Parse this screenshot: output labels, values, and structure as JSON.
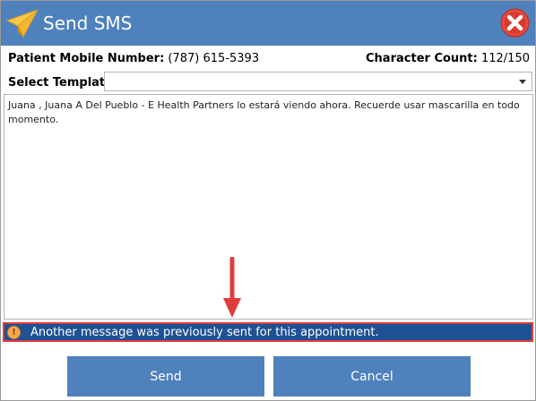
{
  "window": {
    "title": "Send SMS",
    "title_icon": "paper-plane-icon",
    "close_icon": "close-icon"
  },
  "info": {
    "mobile_label": "Patient Mobile Number:",
    "mobile_value": "(787) 615-5393",
    "count_label": "Character Count:",
    "count_value": "112/150"
  },
  "template": {
    "label": "Select Template:",
    "selected": ""
  },
  "message": {
    "text": "Juana , Juana A Del Pueblo - E Health Partners lo estará viendo ahora. Recuerde usar mascarilla en todo momento."
  },
  "notice": {
    "icon": "warning-icon",
    "text": "Another message was previously sent for this appointment."
  },
  "buttons": {
    "send": "Send",
    "cancel": "Cancel"
  },
  "colors": {
    "accent": "#4f81bd",
    "notice_bg": "#1f5294",
    "highlight": "#e03c3c"
  }
}
